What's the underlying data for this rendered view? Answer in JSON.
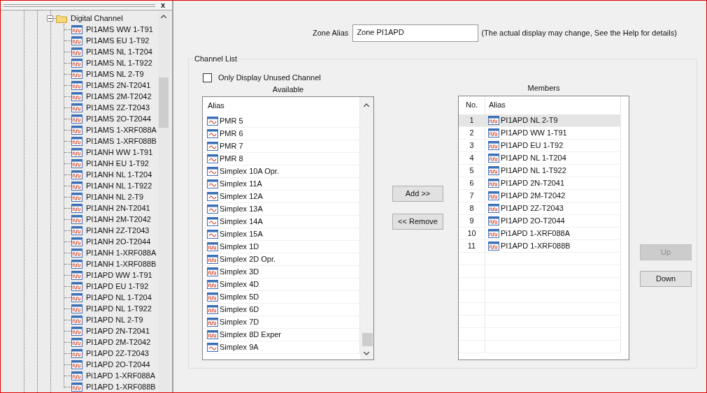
{
  "tree": {
    "label": "Digital Channel",
    "expanded": true,
    "children": [
      {
        "label": "PI1AMS WW 1-T91"
      },
      {
        "label": "PI1AMS EU 1-T92"
      },
      {
        "label": "PI1AMS NL 1-T204"
      },
      {
        "label": "PI1AMS NL 1-T922"
      },
      {
        "label": "PI1AMS NL 2-T9"
      },
      {
        "label": "PI1AMS 2N-T2041"
      },
      {
        "label": "PI1AMS 2M-T2042"
      },
      {
        "label": "PI1AMS 2Z-T2043"
      },
      {
        "label": "PI1AMS 2O-T2044"
      },
      {
        "label": "PI1AMS 1-XRF088A"
      },
      {
        "label": "PI1AMS 1-XRF088B"
      },
      {
        "label": "PI1ANH WW 1-T91"
      },
      {
        "label": "PI1ANH EU 1-T92"
      },
      {
        "label": "PI1ANH NL 1-T204"
      },
      {
        "label": "PI1ANH NL 1-T922"
      },
      {
        "label": "PI1ANH NL 2-T9"
      },
      {
        "label": "PI1ANH 2N-T2041"
      },
      {
        "label": "PI1ANH 2M-T2042"
      },
      {
        "label": "PI1ANH 2Z-T2043"
      },
      {
        "label": "PI1ANH 2O-T2044"
      },
      {
        "label": "PI1ANH 1-XRF088A"
      },
      {
        "label": "PI1ANH 1-XRF088B"
      },
      {
        "label": "PI1APD WW 1-T91"
      },
      {
        "label": "PI1APD EU 1-T92"
      },
      {
        "label": "PI1APD NL 1-T204"
      },
      {
        "label": "PI1APD NL 1-T922"
      },
      {
        "label": "PI1APD NL 2-T9"
      },
      {
        "label": "PI1APD 2N-T2041"
      },
      {
        "label": "PI1APD 2M-T2042"
      },
      {
        "label": "PI1APD 2Z-T2043"
      },
      {
        "label": "PI1APD 2O-T2044"
      },
      {
        "label": "Pi1APD 1-XRF088A"
      },
      {
        "label": "PI1APD 1-XRF088B"
      }
    ]
  },
  "zone_alias": {
    "label": "Zone Alias",
    "value": "Zone PI1APD",
    "hint": "(The actual display may change, See the Help for details)"
  },
  "channel_list": {
    "title": "Channel List",
    "only_unused": {
      "label": "Only Display Unused Channel",
      "checked": false
    },
    "available": {
      "title": "Available",
      "column": "Alias",
      "items": [
        {
          "label": "PMR 5",
          "kind": "analog"
        },
        {
          "label": "PMR 6",
          "kind": "analog"
        },
        {
          "label": "PMR 7",
          "kind": "analog"
        },
        {
          "label": "PMR 8",
          "kind": "analog"
        },
        {
          "label": "Simplex 10A Opr.",
          "kind": "analog"
        },
        {
          "label": "Simplex 11A",
          "kind": "analog"
        },
        {
          "label": "Simplex 12A",
          "kind": "analog"
        },
        {
          "label": "Simplex 13A",
          "kind": "analog"
        },
        {
          "label": "Simplex 14A",
          "kind": "analog"
        },
        {
          "label": "Simplex 15A",
          "kind": "analog"
        },
        {
          "label": "Simplex 1D",
          "kind": "digital"
        },
        {
          "label": "Simplex 2D Opr.",
          "kind": "digital"
        },
        {
          "label": "Simplex 3D",
          "kind": "digital"
        },
        {
          "label": "Simplex 4D",
          "kind": "digital"
        },
        {
          "label": "Simplex 5D",
          "kind": "digital"
        },
        {
          "label": "Simplex 6D",
          "kind": "digital"
        },
        {
          "label": "Simplex 7D",
          "kind": "digital"
        },
        {
          "label": "Simplex 8D Exper",
          "kind": "digital"
        },
        {
          "label": "Simplex 9A",
          "kind": "analog"
        }
      ]
    },
    "add_button": "Add >>",
    "remove_button": "<< Remove",
    "members": {
      "title": "Members",
      "columns": [
        "No.",
        "Alias"
      ],
      "rows": [
        {
          "no": "1",
          "alias": "PI1APD NL 2-T9",
          "selected": true
        },
        {
          "no": "2",
          "alias": "PI1APD WW 1-T91",
          "selected": false
        },
        {
          "no": "3",
          "alias": "PI1APD EU 1-T92",
          "selected": false
        },
        {
          "no": "4",
          "alias": "PI1APD NL 1-T204",
          "selected": false
        },
        {
          "no": "5",
          "alias": "PI1APD NL 1-T922",
          "selected": false
        },
        {
          "no": "6",
          "alias": "PI1APD 2N-T2041",
          "selected": false
        },
        {
          "no": "7",
          "alias": "PI1APD 2M-T2042",
          "selected": false
        },
        {
          "no": "8",
          "alias": "PI1APD 2Z-T2043",
          "selected": false
        },
        {
          "no": "9",
          "alias": "PI1APD 2O-T2044",
          "selected": false
        },
        {
          "no": "10",
          "alias": "Pi1APD 1-XRF088A",
          "selected": false
        },
        {
          "no": "11",
          "alias": "PI1APD 1-XRF088B",
          "selected": false
        }
      ]
    },
    "up_button": {
      "label": "Up",
      "disabled": true
    },
    "down_button": {
      "label": "Down",
      "disabled": false
    }
  },
  "close_glyph": "x"
}
